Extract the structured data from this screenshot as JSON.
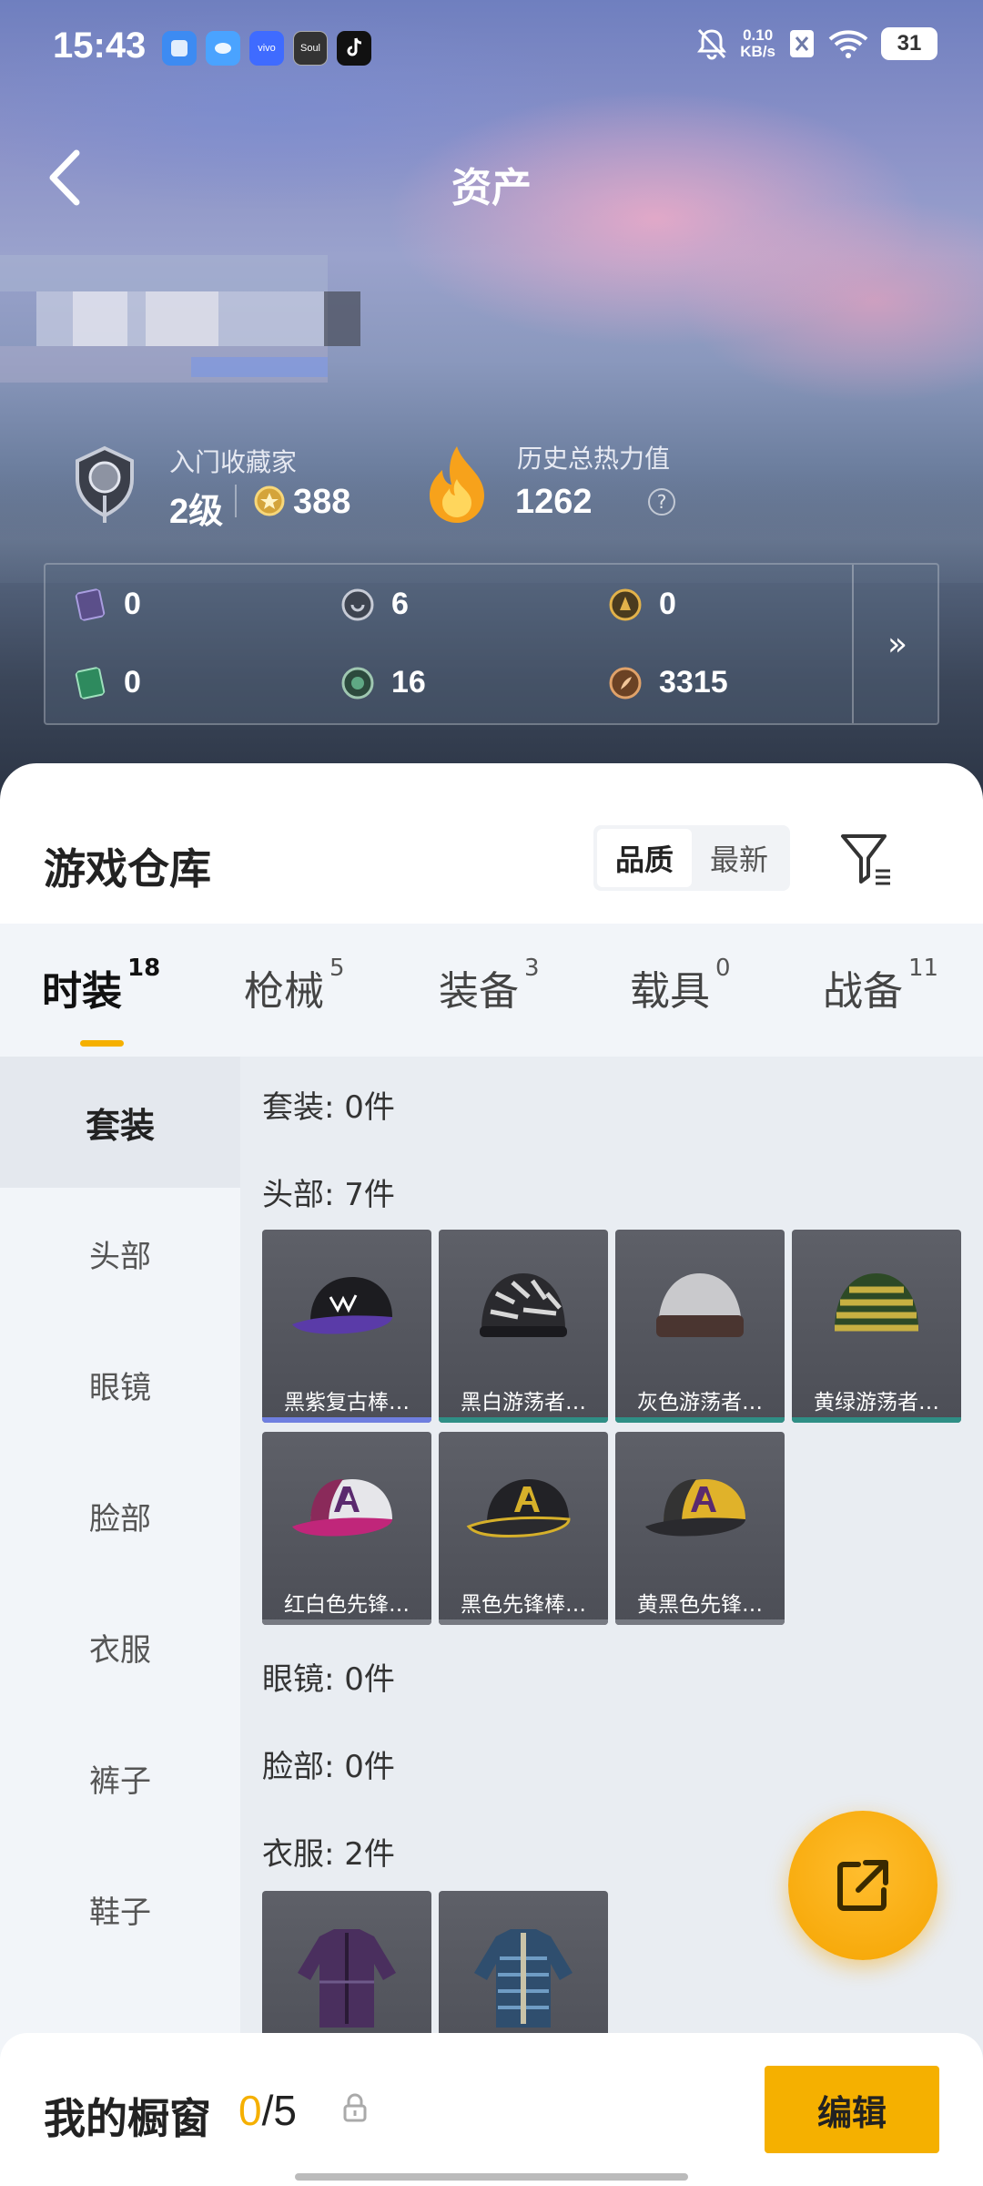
{
  "status_bar": {
    "time": "15:43",
    "apps": [
      "vivo",
      "Soul"
    ],
    "net_speed_value": "0.10",
    "net_speed_unit": "KB/s",
    "battery": "31"
  },
  "header": {
    "title": "资产"
  },
  "profile": {
    "collector_label": "入门收藏家",
    "collector_level": "2级",
    "collector_points": "388",
    "heat_label": "历史总热力值",
    "heat_value": "1262",
    "help": "?"
  },
  "currencies": {
    "row1": [
      "0",
      "6",
      "0"
    ],
    "row2": [
      "0",
      "16",
      "3315"
    ],
    "more": "»"
  },
  "warehouse": {
    "title": "游戏仓库",
    "sort_options": [
      "品质",
      "最新"
    ],
    "tabs": [
      {
        "label": "时装",
        "count": "18"
      },
      {
        "label": "枪械",
        "count": "5"
      },
      {
        "label": "装备",
        "count": "3"
      },
      {
        "label": "载具",
        "count": "0"
      },
      {
        "label": "战备",
        "count": "11"
      }
    ],
    "side_menu": [
      "套装",
      "头部",
      "眼镜",
      "脸部",
      "衣服",
      "裤子",
      "鞋子"
    ],
    "sections": {
      "suit": "套装: 0件",
      "head": "头部: 7件",
      "glasses": "眼镜: 0件",
      "face": "脸部: 0件",
      "clothes": "衣服: 2件"
    },
    "head_items": [
      {
        "name": "黑紫复古棒…",
        "rarity_color": "#6f7fe0"
      },
      {
        "name": "黑白游荡者…",
        "rarity_color": "#2f8f86"
      },
      {
        "name": "灰色游荡者…",
        "rarity_color": "#2f8f86"
      },
      {
        "name": "黄绿游荡者…",
        "rarity_color": "#2f8f86"
      },
      {
        "name": "红白色先锋…",
        "rarity_color": "#777a82"
      },
      {
        "name": "黑色先锋棒…",
        "rarity_color": "#777a82"
      },
      {
        "name": "黄黑色先锋…",
        "rarity_color": "#777a82"
      }
    ]
  },
  "showcase": {
    "label": "我的橱窗",
    "current": "0",
    "total": "/5",
    "edit_label": "编辑"
  },
  "colors": {
    "accent": "#f5b000"
  }
}
